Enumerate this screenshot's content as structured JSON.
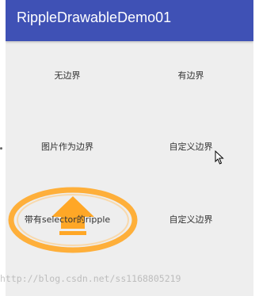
{
  "app": {
    "title": "RippleDrawableDemo01"
  },
  "buttons": [
    {
      "label": "无边界"
    },
    {
      "label": "有边界"
    },
    {
      "label": "图片作为边界"
    },
    {
      "label": "自定义边界"
    },
    {
      "label": "带有selector的ripple"
    },
    {
      "label": "自定义边界"
    }
  ],
  "colors": {
    "app_bar": "#3f51b5",
    "background": "#eeeeee",
    "ripple_accent": "#ffa726"
  },
  "watermark": "http://blog.csdn.net/ss1168805219"
}
